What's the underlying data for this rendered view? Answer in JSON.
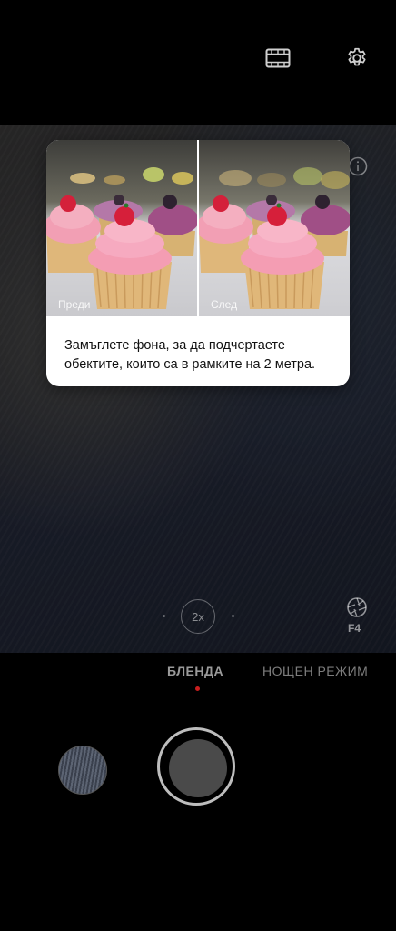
{
  "top_bar": {
    "film_icon": "film-icon",
    "settings_icon": "gear-icon"
  },
  "info_card": {
    "before_label": "Преди",
    "after_label": "След",
    "description": "Замъглете фона, за да подчертаете обектите, които са в рамките на 2 метра."
  },
  "viewfinder": {
    "zoom_label": "2x",
    "aperture_icon": "aperture-icon",
    "aperture_value": "F4",
    "info_icon": "info-icon"
  },
  "modes": {
    "items": [
      "БЛЕНДА",
      "НОЩЕН РЕЖИМ"
    ],
    "active": "БЛЕНДА",
    "indicator_color": "#c81e1e"
  },
  "controls": {
    "gallery_icon": "gallery-thumbnail",
    "shutter_icon": "shutter-button"
  }
}
